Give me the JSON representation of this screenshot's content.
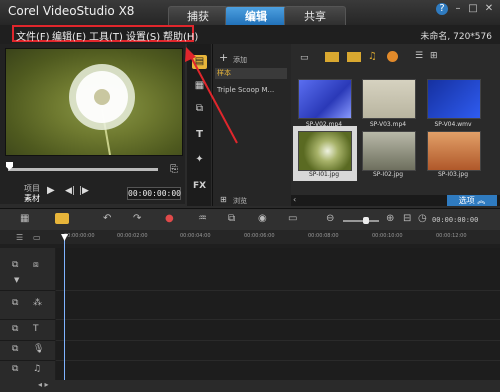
{
  "window": {
    "title": "Corel VideoStudio X8"
  },
  "tabs": [
    {
      "label": "捕获",
      "active": false
    },
    {
      "label": "编辑",
      "active": true
    },
    {
      "label": "共享",
      "active": false
    }
  ],
  "window_controls": {
    "help": "?",
    "minimize": "–",
    "maximize": "□",
    "close": "✕"
  },
  "menu": {
    "items": [
      {
        "label": "文件(F)"
      },
      {
        "label": "编辑(E)"
      },
      {
        "label": "工具(T)"
      },
      {
        "label": "设置(S)"
      },
      {
        "label": "帮助(H)"
      }
    ]
  },
  "project_info": "未命名, 720*576",
  "preview": {
    "mode_label_1": "项目",
    "mode_label_2": "素材",
    "timecode": "00:00:00:00"
  },
  "library": {
    "add_label": "添加",
    "items": [
      "样本",
      "Triple Scoop M..."
    ],
    "browse_label": "浏览"
  },
  "thumbnails": [
    {
      "name": "SP-V02.mp4",
      "color": "#3b4fd0"
    },
    {
      "name": "SP-V03.mp4",
      "color": "#c9c6b3"
    },
    {
      "name": "SP-V04.wmv",
      "color": "#1c3fb0"
    },
    {
      "name": "SP-I01.jpg",
      "color": "#6c7a2e"
    },
    {
      "name": "SP-I02.jpg",
      "color": "#8a8f7a"
    },
    {
      "name": "SP-I03.jpg",
      "color": "#c77a42"
    }
  ],
  "options_label": "选项",
  "ruler_ticks": [
    "00:00:00:00",
    "00:00:02:00",
    "00:00:04:00",
    "00:00:06:00",
    "00:00:08:00",
    "00:00:10:00",
    "00:00:12:00"
  ],
  "colors": {
    "accent": "#2f7bc0",
    "annotation": "#e0262c"
  }
}
